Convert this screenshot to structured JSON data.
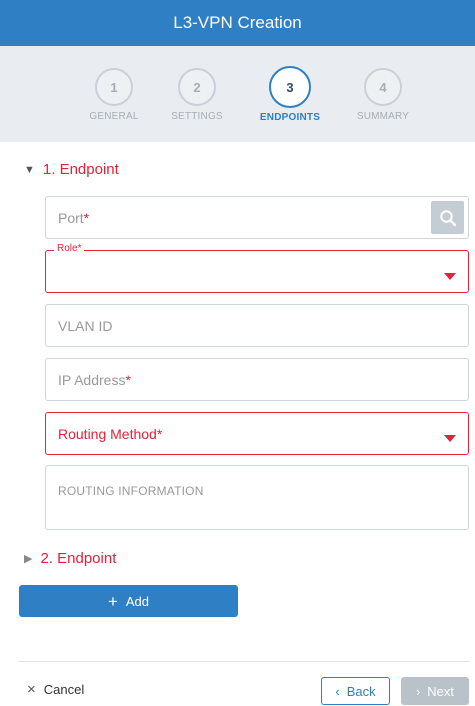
{
  "header": {
    "title": "L3-VPN Creation"
  },
  "steps": [
    {
      "number": "1",
      "label": "GENERAL"
    },
    {
      "number": "2",
      "label": "SETTINGS"
    },
    {
      "number": "3",
      "label": "ENDPOINTS"
    },
    {
      "number": "4",
      "label": "SUMMARY"
    }
  ],
  "active_step": 3,
  "endpoint1": {
    "title": "1. Endpoint",
    "port_placeholder": "Port",
    "role_label": "Role*",
    "vlan_placeholder": "VLAN ID",
    "ip_placeholder": "IP Address",
    "routing_method": "Routing Method",
    "routing_information": "ROUTING INFORMATION",
    "required_mark": "*"
  },
  "endpoint2": {
    "title": "2. Endpoint"
  },
  "add_button": {
    "label": "Add",
    "icon": "+"
  },
  "footer": {
    "cancel_label": "Cancel",
    "cancel_icon": "×",
    "back_label": "Back",
    "back_icon": "‹",
    "next_label": "Next",
    "next_icon": "›"
  },
  "colors": {
    "primary": "#2f7fc4",
    "error": "#e1233b",
    "disabled": "#b9c1c9"
  }
}
